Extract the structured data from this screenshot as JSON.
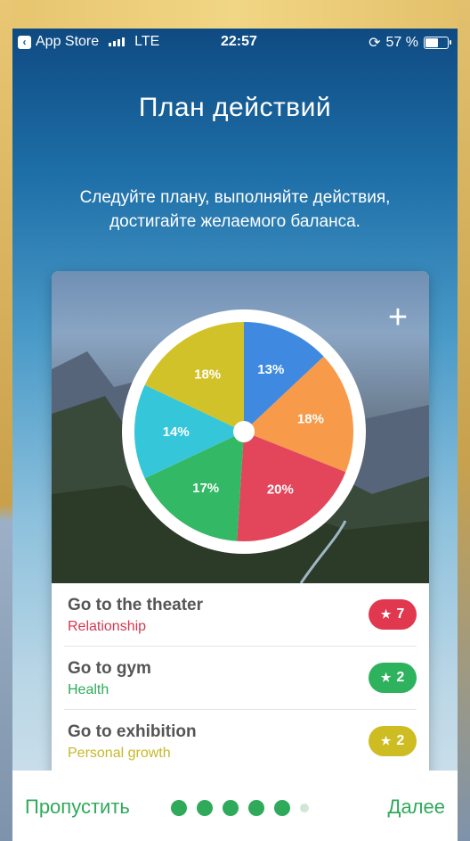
{
  "status": {
    "back_app": "App Store",
    "carrier": "LTE",
    "time": "22:57",
    "battery": "57 %"
  },
  "header": {
    "title": "План действий",
    "subtitle": "Следуйте плану, выполняйте действия, достигайте желаемого баланса."
  },
  "chart_data": {
    "type": "pie",
    "slices": [
      {
        "label": "13%",
        "value": 13,
        "color": "#3f8ae0"
      },
      {
        "label": "18%",
        "value": 18,
        "color": "#f79a4a"
      },
      {
        "label": "20%",
        "value": 20,
        "color": "#e3455a"
      },
      {
        "label": "17%",
        "value": 17,
        "color": "#33b866"
      },
      {
        "label": "14%",
        "value": 14,
        "color": "#36c6da"
      },
      {
        "label": "18%",
        "value": 18,
        "color": "#d2c22a"
      }
    ]
  },
  "actions": [
    {
      "name": "Go to the theater",
      "category": "Relationship",
      "category_color": "#d6394f",
      "count": "7",
      "badge_color": "#e0384e"
    },
    {
      "name": "Go to gym",
      "category": "Health",
      "category_color": "#2eaa5a",
      "count": "2",
      "badge_color": "#2fb25e"
    },
    {
      "name": "Go to exhibition",
      "category": "Personal growth",
      "category_color": "#c7b82a",
      "count": "2",
      "badge_color": "#cdbd22"
    }
  ],
  "footer": {
    "skip": "Пропустить",
    "next": "Далее",
    "pages_total": 6,
    "pages_active": 5
  },
  "icons": {
    "add": "plus-icon",
    "star": "star-icon",
    "back": "chevron-left-icon"
  }
}
